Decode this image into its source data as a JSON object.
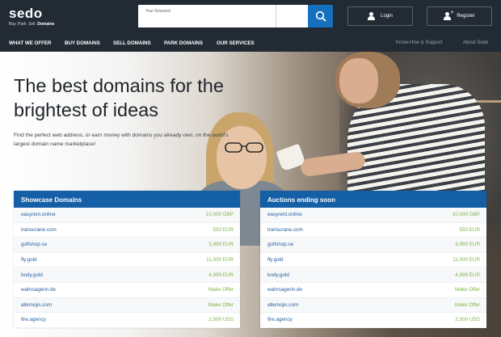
{
  "brand": {
    "name": "sedo",
    "tagline_plain": "Buy. Park. Sell.",
    "tagline_bold": "Domains"
  },
  "search": {
    "placeholder": "Your Keyword"
  },
  "header": {
    "login_label": "Login",
    "register_label": "Register"
  },
  "nav": {
    "items": [
      "WHAT WE OFFER",
      "BUY DOMAINS",
      "SELL DOMAINS",
      "PARK DOMAINS",
      "OUR SERVICES"
    ],
    "right": [
      "Know-How & Support",
      "About Sedo"
    ]
  },
  "hero": {
    "title": "The best domains for the brightest of ideas",
    "subtitle": "Find the perfect web address, or earn money with domains you already own, on the world's largest domain name marketplace!"
  },
  "showcase": {
    "title": "Showcase Domains",
    "rows": [
      {
        "domain": "easyrent.online",
        "price": "10,000 GBP"
      },
      {
        "domain": "transurane.com",
        "price": "550 EUR"
      },
      {
        "domain": "golfshop.se",
        "price": "3,999 EUR"
      },
      {
        "domain": "fly.gold",
        "price": "11,000 EUR"
      },
      {
        "domain": "body.gold",
        "price": "4,999 EUR"
      },
      {
        "domain": "wahrsagerin.de",
        "price": "Make Offer"
      },
      {
        "domain": "allemojis.com",
        "price": "Make Offer"
      },
      {
        "domain": "fire.agency",
        "price": "2,500 USD"
      }
    ]
  },
  "auctions": {
    "title": "Auctions ending soon",
    "rows": [
      {
        "domain": "easyrent.online",
        "price": "10,000 GBP"
      },
      {
        "domain": "transurane.com",
        "price": "550 EUR"
      },
      {
        "domain": "golfshop.se",
        "price": "3,999 EUR"
      },
      {
        "domain": "fly.gold",
        "price": "11,000 EUR"
      },
      {
        "domain": "body.gold",
        "price": "4,999 EUR"
      },
      {
        "domain": "wahrsagerin.de",
        "price": "Make Offer"
      },
      {
        "domain": "allemojis.com",
        "price": "Make Offer"
      },
      {
        "domain": "fire.agency",
        "price": "2,500 USD"
      }
    ]
  },
  "colors": {
    "header_bg": "#222a33",
    "accent_blue": "#145fa6",
    "search_button": "#1571bd",
    "price_green": "#7fb347",
    "domain_link": "#2760a0"
  }
}
